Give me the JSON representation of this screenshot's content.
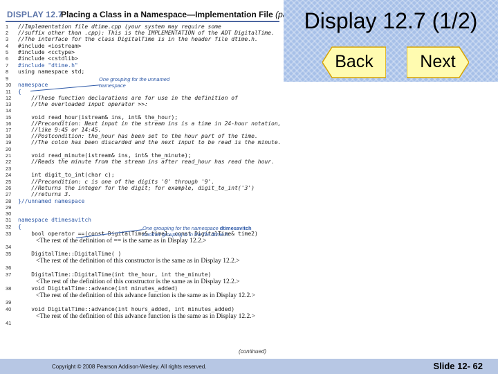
{
  "display": {
    "label": "DISPLAY 12.7",
    "caption": "Placing a Class in a Namespace—Implementation File",
    "part": "(part 1 of 2)"
  },
  "title": "Display 12.7 (1/2)",
  "nav": {
    "back": "Back",
    "next": "Next"
  },
  "code_lines": [
    {
      "n": "1",
      "text": "//Implementation file dtime.cpp (your system may require some",
      "kind": "comment"
    },
    {
      "n": "2",
      "text": "//suffix other than .cpp): This is the IMPLEMENTATION of the ADT DigitalTime.",
      "kind": "comment"
    },
    {
      "n": "3",
      "text": "//The interface for the class DigitalTime is in the header file dtime.h.",
      "kind": "comment"
    },
    {
      "n": "4",
      "text": "#include <iostream>",
      "kind": "code"
    },
    {
      "n": "5",
      "text": "#include <cctype>",
      "kind": "code"
    },
    {
      "n": "6",
      "text": "#include <cstdlib>",
      "kind": "code"
    },
    {
      "n": "7",
      "text": "#include \"dtime.h\"",
      "kind": "highlight"
    },
    {
      "n": "8",
      "text": "using namespace std;",
      "kind": "code"
    },
    {
      "n": "9",
      "text": "",
      "kind": "code"
    },
    {
      "n": "10",
      "text": "namespace",
      "kind": "highlight"
    },
    {
      "n": "11",
      "text": "{",
      "kind": "highlight"
    },
    {
      "n": "12",
      "text": "    //These function declarations are for use in the definition of",
      "kind": "comment"
    },
    {
      "n": "13",
      "text": "    //the overloaded input operator >>:",
      "kind": "comment"
    },
    {
      "n": "14",
      "text": "",
      "kind": "code"
    },
    {
      "n": "15",
      "text": "    void read_hour(istream& ins, int& the_hour);",
      "kind": "code"
    },
    {
      "n": "16",
      "text": "    //Precondition: Next input in the stream ins is a time in 24-hour notation,",
      "kind": "comment"
    },
    {
      "n": "17",
      "text": "    //like 9:45 or 14:45.",
      "kind": "comment"
    },
    {
      "n": "18",
      "text": "    //Postcondition: the_hour has been set to the hour part of the time.",
      "kind": "comment"
    },
    {
      "n": "19",
      "text": "    //The colon has been discarded and the next input to be read is the minute.",
      "kind": "comment"
    },
    {
      "n": "20",
      "text": "",
      "kind": "code"
    },
    {
      "n": "21",
      "text": "    void read_minute(istream& ins, int& the_minute);",
      "kind": "code"
    },
    {
      "n": "22",
      "text": "    //Reads the minute from the stream ins after read_hour has read the hour.",
      "kind": "comment"
    },
    {
      "n": "23",
      "text": "",
      "kind": "code"
    },
    {
      "n": "24",
      "text": "    int digit_to_int(char c);",
      "kind": "code"
    },
    {
      "n": "25",
      "text": "    //Precondition: c is one of the digits '0' through '9'.",
      "kind": "comment"
    },
    {
      "n": "26",
      "text": "    //Returns the integer for the digit; for example, digit_to_int('3')",
      "kind": "comment"
    },
    {
      "n": "27",
      "text": "    //returns 3.",
      "kind": "comment"
    },
    {
      "n": "28",
      "text": "}//unnamed namespace",
      "kind": "highlight"
    },
    {
      "n": "29",
      "text": "",
      "kind": "code"
    },
    {
      "n": "30",
      "text": "",
      "kind": "code"
    },
    {
      "n": "31",
      "text": "namespace dtimesavitch",
      "kind": "highlight"
    },
    {
      "n": "32",
      "text": "{",
      "kind": "highlight"
    },
    {
      "n": "33",
      "text": "    bool operator ==(const DigitalTime& time1, const DigitalTime& time2)",
      "kind": "code"
    },
    {
      "n": "",
      "text": "<The rest of the definition of == is the same as in Display 12.2.>",
      "kind": "prose"
    },
    {
      "n": "34",
      "text": "",
      "kind": "code"
    },
    {
      "n": "35",
      "text": "    DigitalTime::DigitalTime( )",
      "kind": "code"
    },
    {
      "n": "",
      "text": "<The rest of the definition of this constructor is the same as in Display 12.2.>",
      "kind": "prose"
    },
    {
      "n": "36",
      "text": "",
      "kind": "code"
    },
    {
      "n": "37",
      "text": "    DigitalTime::DigitalTime(int the_hour, int the_minute)",
      "kind": "code"
    },
    {
      "n": "",
      "text": "<The rest of the definition of this constructor is the same as in Display 12.2.>",
      "kind": "prose"
    },
    {
      "n": "38",
      "text": "    void DigitalTime::advance(int minutes_added)",
      "kind": "code"
    },
    {
      "n": "",
      "text": "<The rest of the definition of this advance function is the same as in Display 12.2.>",
      "kind": "prose"
    },
    {
      "n": "39",
      "text": "",
      "kind": "code"
    },
    {
      "n": "40",
      "text": "    void DigitalTime::advance(int hours_added, int minutes_added)",
      "kind": "code"
    },
    {
      "n": "",
      "text": "<The rest of the definition of this advance function is the same as in Display 12.2.>",
      "kind": "prose"
    },
    {
      "n": "41",
      "text": "",
      "kind": "code"
    }
  ],
  "notes": {
    "unnamed_1": "One grouping for the unnamed",
    "unnamed_2": "namespace",
    "dts_1": "One grouping for the namespace",
    "dts_bold": "dtimesavitch",
    "dts_2": "Another grouping is in the file dtime.h."
  },
  "continued": "(continued)",
  "footer": {
    "copyright": "Copyright © 2008 Pearson Addison-Wesley.  All rights reserved.",
    "slide": "Slide 12- 62"
  },
  "colors": {
    "panel": "#a7c0e8",
    "footer": "#b7c7e4",
    "button_fill": "#fffbb0",
    "button_stroke": "#d9a400",
    "code_highlight": "#2f5aa8"
  }
}
